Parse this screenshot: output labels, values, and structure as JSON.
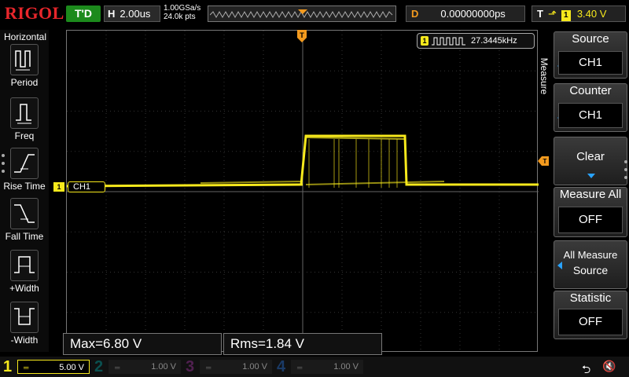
{
  "topbar": {
    "brand": "RIGOL",
    "trigger_status": "T'D",
    "horizontal_label": "H",
    "timebase": "2.00us",
    "sample_rate": "1.00GSa/s",
    "memory_points": "24.0k pts",
    "delay_label": "D",
    "delay_value": "0.00000000ps",
    "trigger_label": "T",
    "trigger_source": "1",
    "trigger_level": "3.40 V"
  },
  "left_menu": {
    "title": "Horizontal",
    "items": [
      {
        "label": "Period",
        "icon": "period-icon"
      },
      {
        "label": "Freq",
        "icon": "frequency-icon"
      },
      {
        "label": "Rise Time",
        "icon": "rise-time-icon"
      },
      {
        "label": "Fall Time",
        "icon": "fall-time-icon"
      },
      {
        "label": "+Width",
        "icon": "positive-width-icon"
      },
      {
        "label": "-Width",
        "icon": "negative-width-icon"
      }
    ]
  },
  "display": {
    "channel_tag": "CH1",
    "channel_marker": "1",
    "counter": {
      "channel": "1",
      "value": "27.3445kHz"
    },
    "measurements": [
      {
        "label": "Max=6.80 V"
      },
      {
        "label": "Rms=1.84 V"
      }
    ],
    "trace_color": "#f7e91c",
    "trigger_color": "#f39a1e"
  },
  "right_menu": {
    "title": "Measure",
    "source": {
      "label": "Source",
      "value": "CH1"
    },
    "counter": {
      "label": "Counter",
      "value": "CH1"
    },
    "clear": {
      "label": "Clear"
    },
    "measure_all": {
      "label": "Measure All",
      "value": "OFF"
    },
    "all_measure_source": {
      "label_line1": "All Measure",
      "label_line2": "Source"
    },
    "statistic": {
      "label": "Statistic",
      "value": "OFF"
    }
  },
  "bottombar": {
    "channels": [
      {
        "num": "1",
        "scale": "5.00 V",
        "color": "#f7e91c",
        "active": true
      },
      {
        "num": "2",
        "scale": "1.00 V",
        "color": "#00c8c8",
        "active": false
      },
      {
        "num": "3",
        "scale": "1.00 V",
        "color": "#e040e0",
        "active": false
      },
      {
        "num": "4",
        "scale": "1.00 V",
        "color": "#2a8cff",
        "active": false
      }
    ]
  }
}
